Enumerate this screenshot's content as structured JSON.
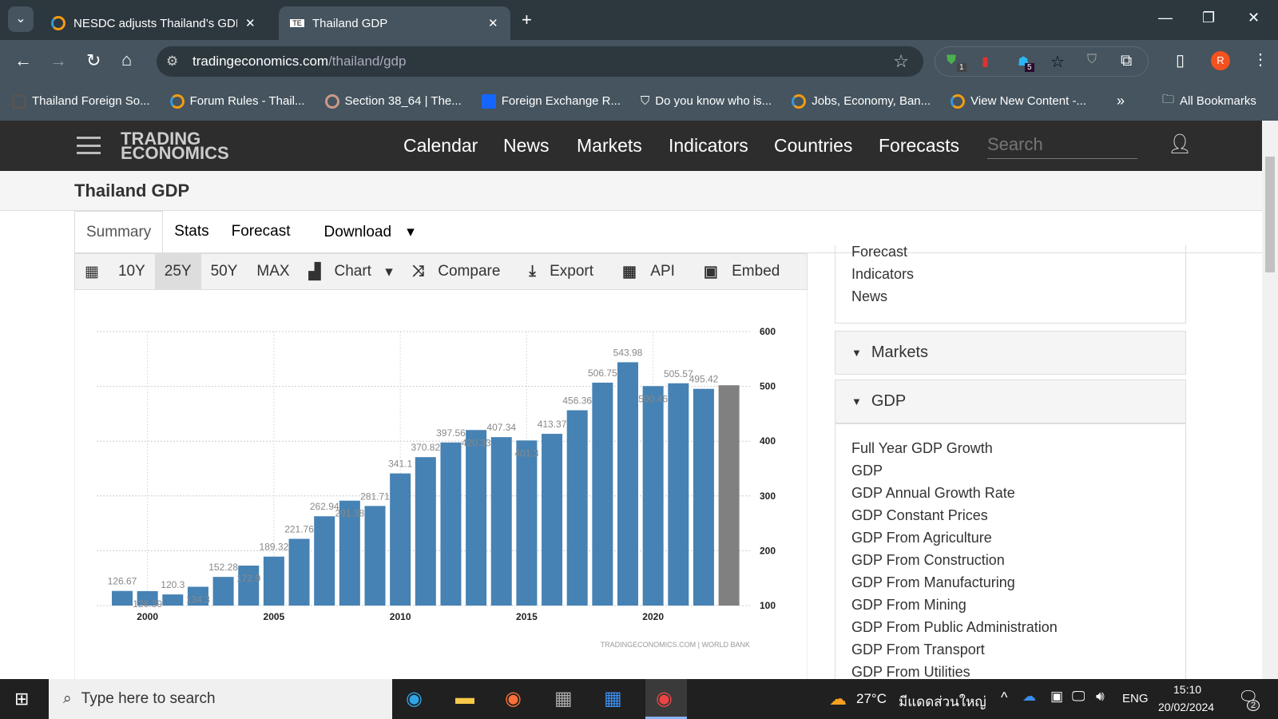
{
  "browser": {
    "tabs": [
      {
        "title": "NESDC adjusts Thailand’s GDP g"
      },
      {
        "title": "Thailand GDP"
      }
    ],
    "url_host": "tradingeconomics.com",
    "url_path": "/thailand/gdp",
    "bookmarks": [
      "Thailand Foreign So...",
      "Forum Rules - Thail...",
      "Section 38_64 | The...",
      "Foreign Exchange R...",
      "Do you know who is...",
      "Jobs, Economy, Ban...",
      "View New Content -..."
    ],
    "all_bookmarks": "All Bookmarks",
    "ext_badges": [
      "1",
      "5"
    ],
    "profile": "R"
  },
  "site": {
    "logo": "TRADING ECONOMICS",
    "nav": [
      "Calendar",
      "News",
      "Markets",
      "Indicators",
      "Countries",
      "Forecasts"
    ],
    "search_placeholder": "Search"
  },
  "page": {
    "title": "Thailand GDP",
    "tabs": [
      "Summary",
      "Stats",
      "Forecast",
      "Download"
    ],
    "chart_toolbar": [
      "10Y",
      "25Y",
      "50Y",
      "MAX",
      "Chart",
      "Compare",
      "Export",
      "API",
      "Embed"
    ],
    "selected_range": "25Y"
  },
  "sidebar": {
    "top_links": [
      "Forecast",
      "Indicators",
      "News"
    ],
    "sections": [
      "Markets",
      "GDP"
    ],
    "gdp_links": [
      "Full Year GDP Growth",
      "GDP",
      "GDP Annual Growth Rate",
      "GDP Constant Prices",
      "GDP From Agriculture",
      "GDP From Construction",
      "GDP From Manufacturing",
      "GDP From Mining",
      "GDP From Public Administration",
      "GDP From Transport",
      "GDP From Utilities"
    ]
  },
  "chart_data": {
    "type": "bar",
    "x": [
      1999,
      2000,
      2001,
      2002,
      2003,
      2004,
      2005,
      2006,
      2007,
      2008,
      2009,
      2010,
      2011,
      2012,
      2013,
      2014,
      2015,
      2016,
      2017,
      2018,
      2019,
      2020,
      2021,
      2022,
      2023
    ],
    "values": [
      126.67,
      126.39,
      120.3,
      134.3,
      152.28,
      172.9,
      189.32,
      221.76,
      262.94,
      291.38,
      281.71,
      341.1,
      370.82,
      397.56,
      420.33,
      407.34,
      401.3,
      413.37,
      456.36,
      506.75,
      543.98,
      500.46,
      505.57,
      495.42,
      502
    ],
    "labels_shown": [
      true,
      true,
      true,
      true,
      true,
      true,
      true,
      true,
      true,
      true,
      true,
      true,
      true,
      true,
      true,
      true,
      true,
      true,
      true,
      true,
      true,
      true,
      true,
      true,
      false
    ],
    "forecast_last": true,
    "xticks": [
      2000,
      2005,
      2010,
      2015,
      2020
    ],
    "yticks": [
      100,
      200,
      300,
      400,
      500,
      600
    ],
    "ylim": [
      100,
      600
    ],
    "axis_side": "right",
    "grid": true,
    "bar_color": "#4682b4",
    "forecast_color": "#808080",
    "source": "TRADINGECONOMICS.COM | WORLD BANK"
  },
  "taskbar": {
    "search_placeholder": "Type here to search",
    "weather": "27°C",
    "weather_text": "มีแดดส่วนใหญ่",
    "lang": "ENG",
    "time": "15:10",
    "date": "20/02/2024",
    "notifications": "2"
  }
}
